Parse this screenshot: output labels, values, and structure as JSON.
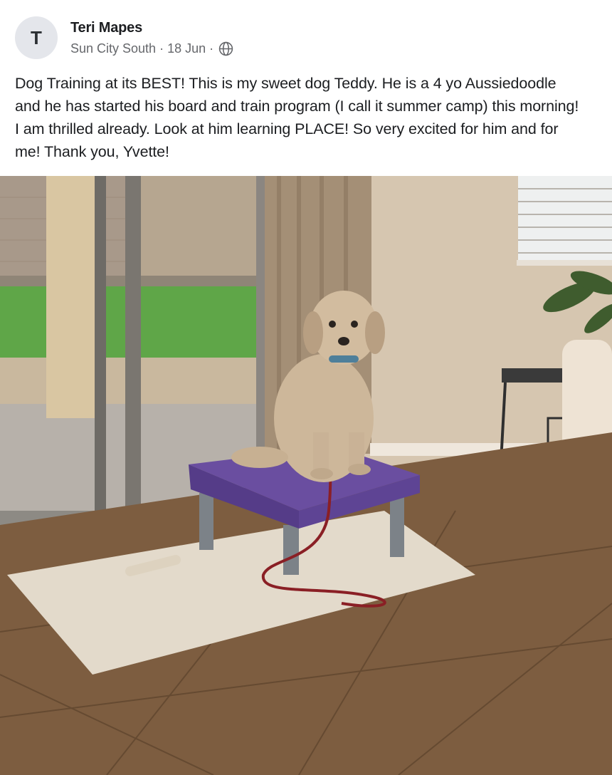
{
  "author": {
    "avatar_initial": "T",
    "name": "Teri Mapes"
  },
  "meta": {
    "group": "Sun City South",
    "separator": "·",
    "date": "18 Jun",
    "privacy_icon": "globe-icon"
  },
  "post": {
    "text": "Dog Training at its BEST! This is my sweet dog Teddy. He is a 4 yo Aussiedoodle and he has started his board and train program (I call it summer camp) this morning! I am thrilled already. Look at him learning PLACE! So very excited for him and for me! Thank you, Yvette!"
  },
  "colors": {
    "text_primary": "#1c1e21",
    "text_secondary": "#65676b",
    "avatar_bg": "#e4e6eb"
  }
}
